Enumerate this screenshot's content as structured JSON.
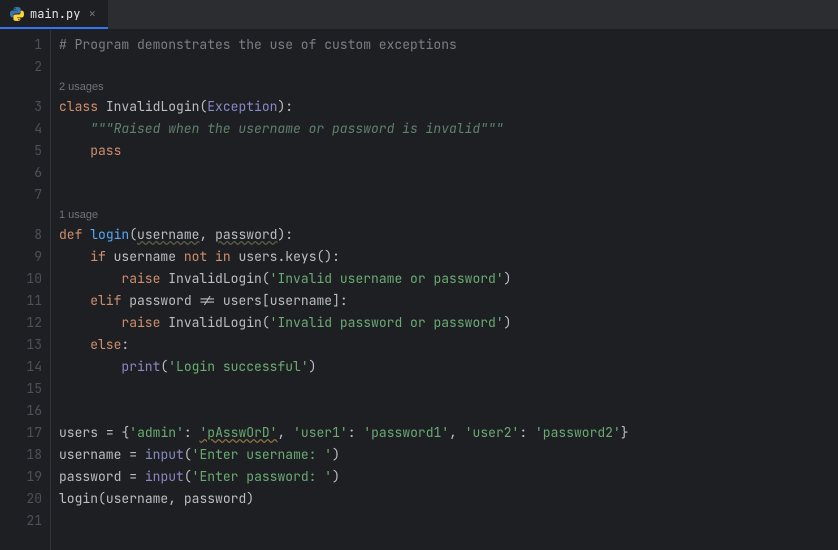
{
  "tab": {
    "filename": "main.py",
    "close_glyph": "×"
  },
  "inlays": {
    "class_usages": "2 usages",
    "func_usages": "1 usage"
  },
  "gutter": [
    "1",
    "2",
    "",
    "3",
    "4",
    "5",
    "6",
    "7",
    "",
    "8",
    "9",
    "10",
    "11",
    "12",
    "13",
    "14",
    "15",
    "16",
    "17",
    "18",
    "19",
    "20",
    "21"
  ],
  "code": {
    "l1": {
      "comment": "# Program demonstrates the use of custom exceptions"
    },
    "l3": {
      "kw": "class",
      "name": "InvalidLogin",
      "base": "Exception"
    },
    "l4": {
      "doc": "\"\"\"Raised when the username or password is invalid\"\"\""
    },
    "l5": {
      "kw": "pass"
    },
    "l8": {
      "kw": "def",
      "name": "login",
      "p1": "username",
      "p2": "password"
    },
    "l9": {
      "kw1": "if",
      "id": "username",
      "kw2": "not in",
      "obj": "users",
      "method": "keys"
    },
    "l10": {
      "kw": "raise",
      "cls": "InvalidLogin",
      "str": "'Invalid username or password'"
    },
    "l11": {
      "kw": "elif",
      "id1": "password",
      "op": "!=",
      "obj": "users",
      "idx": "username"
    },
    "l12": {
      "kw": "raise",
      "cls": "InvalidLogin",
      "str": "'Invalid password or password'"
    },
    "l13": {
      "kw": "else"
    },
    "l14": {
      "fn": "print",
      "str": "'Login successful'"
    },
    "l17": {
      "id": "users",
      "k1": "'admin'",
      "v1": "'pAsswOrD'",
      "k2": "'user1'",
      "v2": "'password1'",
      "k3": "'user2'",
      "v3": "'password2'"
    },
    "l18": {
      "id": "username",
      "fn": "input",
      "str": "'Enter username: '"
    },
    "l19": {
      "id": "password",
      "fn": "input",
      "str": "'Enter password: '"
    },
    "l20": {
      "fn": "login",
      "a1": "username",
      "a2": "password"
    }
  }
}
